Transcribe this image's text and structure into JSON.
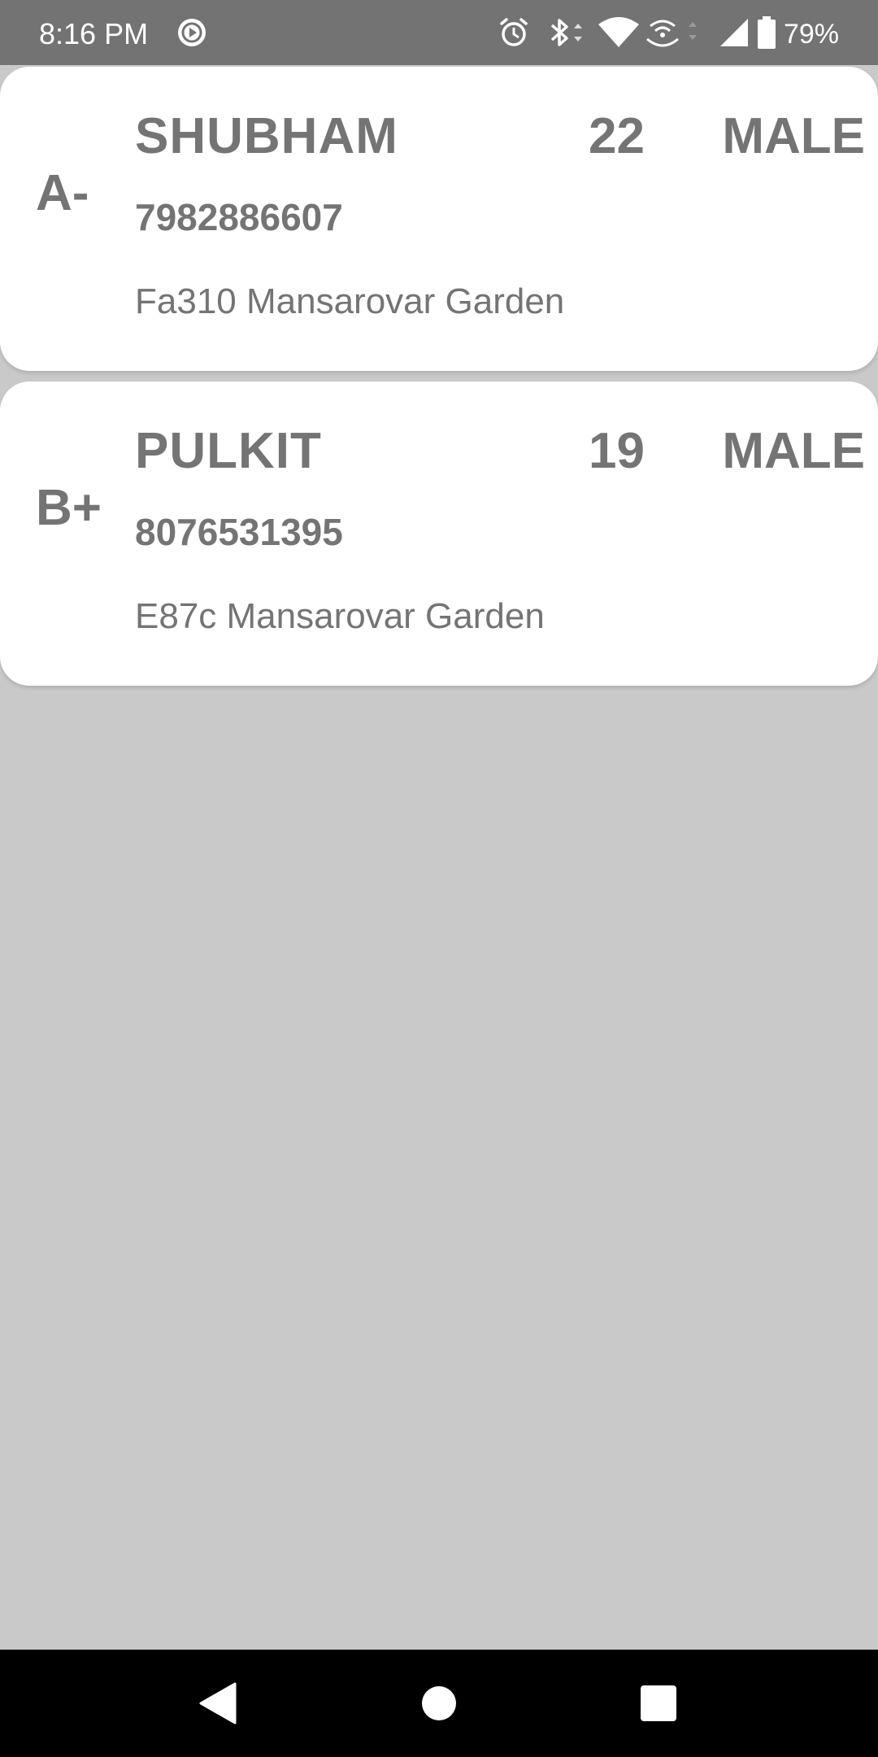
{
  "status_bar": {
    "time": "8:16 PM",
    "battery_percent": "79%",
    "icons": [
      "media-play-icon",
      "alarm-icon",
      "bluetooth-icon",
      "wifi-icon",
      "hotspot-icon",
      "cell-signal-icon",
      "battery-icon"
    ]
  },
  "donors": [
    {
      "blood_group": "A-",
      "name": "SHUBHAM",
      "age": "22",
      "gender": "MALE",
      "phone": "7982886607",
      "address": "Fa310 Mansarovar Garden"
    },
    {
      "blood_group": "B+",
      "name": "PULKIT",
      "age": "19",
      "gender": "MALE",
      "phone": "8076531395",
      "address": "E87c Mansarovar Garden"
    }
  ],
  "nav_bar": {
    "icons": [
      "back-icon",
      "home-icon",
      "recents-icon"
    ]
  },
  "colors": {
    "status_bar_bg": "#737373",
    "page_bg": "#c9c9c9",
    "card_bg": "#ffffff",
    "text": "#747474",
    "nav_bar_bg": "#000000"
  }
}
